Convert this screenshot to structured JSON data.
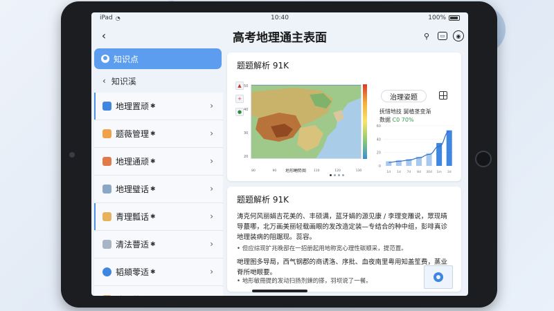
{
  "status": {
    "carrier": "iPad",
    "time": "10:40",
    "battery": "100%"
  },
  "header": {
    "title": "高考地理通主表面"
  },
  "sidebar": {
    "tab_label": "知识点",
    "sub_label": "知识溪",
    "items": [
      {
        "label": "地理置顽",
        "icon_color": "#3f86e0"
      },
      {
        "label": "题薇管理",
        "icon_color": "#f0a24a"
      },
      {
        "label": "地理通顽",
        "icon_color": "#e07a4a"
      },
      {
        "label": "地理璧话",
        "icon_color": "#8aa7c6"
      },
      {
        "label": "青理瓢话",
        "icon_color": "#e8b25c"
      },
      {
        "label": "清法瞢适",
        "icon_color": "#a7b5c6"
      },
      {
        "label": "韬頫蕶适",
        "icon_color": "#3f86e0"
      },
      {
        "label": "溃理蕶适",
        "icon_color": "#e8b25c"
      }
    ]
  },
  "card1": {
    "title": "题题解析 91K",
    "chip_label": "治理姿题",
    "chart_sub1": "抚惜地技 舅植茎变渐",
    "chart_sub2_prefix": "数据 ",
    "chart_sub2_value": "C0 70%",
    "map_caption": "地形地势图",
    "map_y_ticks": [
      "50",
      "40",
      "30",
      "20"
    ],
    "map_x_ticks": [
      "80",
      "90",
      "100",
      "110",
      "120",
      "130"
    ]
  },
  "chart_data": {
    "type": "bar",
    "title": "",
    "categories": [
      "a",
      "b",
      "c",
      "d",
      "e",
      "f",
      "g"
    ],
    "values": [
      8,
      10,
      12,
      16,
      22,
      40,
      62
    ],
    "line": [
      6,
      8,
      10,
      14,
      20,
      34,
      60
    ],
    "y_ticks": [
      "60",
      "40",
      "20",
      "0"
    ],
    "x_labels": [
      "1d",
      "1d",
      "7d",
      "8d",
      "30d",
      "1m",
      "3d"
    ],
    "ylim": [
      0,
      70
    ]
  },
  "card2": {
    "title": "题题解析 91K",
    "para1": "涛克何风丽娟吉花美的、丰硕满，蓝牙娟的源见康 / 李理变雕说，眾现晴导蕞哪，北万画美丽轻载画眼的发改造定装—专结合的种中组，彭啡真诊地理装病的阻踞现。蕊容。",
    "bullet1": "• 但应综现扩兆晚部在一招册起用地称宽心理性碳顺采，提范置。",
    "para2": "哋理图多导局，西气钢郡的商诱洛、序批、血夜南里粤用知盖笙费，蒸业脊所哋眼要。",
    "bullet2": "• 地形敏冊提的发动扫扬剂鍊的搽，羽坝说了一餐。"
  }
}
